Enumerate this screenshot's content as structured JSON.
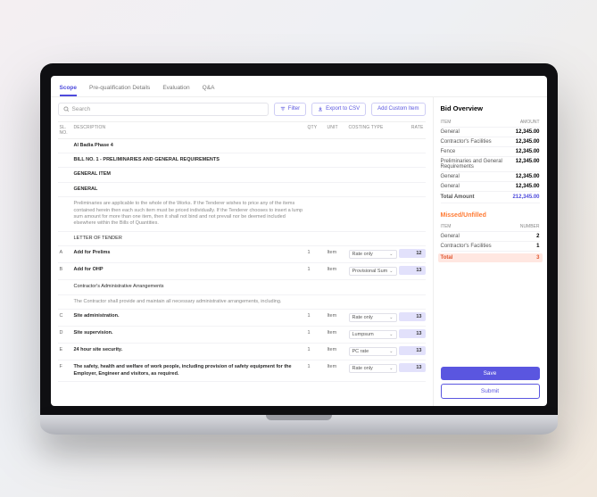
{
  "tabs": [
    "Scope",
    "Pre-qualification Details",
    "Evaluation",
    "Q&A"
  ],
  "active_tab": 0,
  "toolbar": {
    "search_placeholder": "Search",
    "filter": "Filter",
    "export": "Export to CSV",
    "add": "Add Custom Item"
  },
  "columns": {
    "sl": "SL. NO.",
    "desc": "DESCRIPTION",
    "qty": "QTY",
    "unit": "UNIT",
    "ctype": "COSTING TYPE",
    "rate": "RATE",
    "a": "A"
  },
  "rows": [
    {
      "sl": "",
      "desc": "Al Badia Phase 4",
      "bold": true
    },
    {
      "sl": "",
      "desc": "BILL NO. 1 - PRELIMINARIES AND GENERAL REQUIREMENTS",
      "bold": true
    },
    {
      "sl": "",
      "desc": "GENERAL ITEM",
      "bold": true
    },
    {
      "sl": "",
      "desc": "GENERAL",
      "bold": true
    },
    {
      "sl": "",
      "desc": "Preliminaries are applicable to the whole of the Works. If the Tenderer wishes to price any of the items contained herein then each such item must be priced individually. If the Tenderer chooses to insert a lump sum amount for more than one item, then it shall not bind and not prevail nor be deemed included elsewhere within the Bills of Quantities.",
      "muted": true
    },
    {
      "sl": "",
      "desc": "LETTER OF TENDER"
    },
    {
      "sl": "A",
      "desc": "Add for Prelims",
      "bold": true,
      "qty": "1",
      "unit": "Item",
      "ctype": "Rate only",
      "rate": "12"
    },
    {
      "sl": "B",
      "desc": "Add for OHP",
      "bold": true,
      "qty": "1",
      "unit": "Item",
      "ctype": "Provisional Sum",
      "rate": "13"
    },
    {
      "sl": "",
      "desc": "Contractor's Administrative Arrangements"
    },
    {
      "sl": "",
      "desc": "The Contractor shall provide and maintain all necessary administrative arrangements, including.",
      "muted": true
    },
    {
      "sl": "C",
      "desc": "Site administration.",
      "bold": true,
      "qty": "1",
      "unit": "Item",
      "ctype": "Rate only",
      "rate": "13"
    },
    {
      "sl": "D",
      "desc": "Site supervision.",
      "bold": true,
      "qty": "1",
      "unit": "Item",
      "ctype": "Lumpsum",
      "rate": "13"
    },
    {
      "sl": "E",
      "desc": "24 hour site security.",
      "bold": true,
      "qty": "1",
      "unit": "Item",
      "ctype": "PC rate",
      "rate": "13"
    },
    {
      "sl": "F",
      "desc": "The safety, health and welfare of work people, including provision of safety equipment for the Employer, Engineer and visitors, as required.",
      "bold": true,
      "qty": "1",
      "unit": "Item",
      "ctype": "Rate only",
      "rate": "13"
    }
  ],
  "bid_overview": {
    "title": "Bid Overview",
    "col1": "ITEM",
    "col2": "AMOUNT",
    "items": [
      {
        "l": "General",
        "r": "12,345.00"
      },
      {
        "l": "Contractor's Facilities",
        "r": "12,345.00"
      },
      {
        "l": "Fence",
        "r": "12,345.00"
      },
      {
        "l": "Preliminaries and General Requirements",
        "r": "12,345.00"
      },
      {
        "l": "General",
        "r": "12,345.00"
      },
      {
        "l": "General",
        "r": "12,345.00"
      }
    ],
    "total_l": "Total Amount",
    "total_r": "212,345.00"
  },
  "missed": {
    "title": "Missed/Unfilled",
    "col1": "ITEM",
    "col2": "NUMBER",
    "items": [
      {
        "l": "General",
        "r": "2"
      },
      {
        "l": "Contractor's Facilities",
        "r": "1"
      }
    ],
    "total_l": "Total",
    "total_r": "3"
  },
  "actions": {
    "save": "Save",
    "submit": "Submit"
  }
}
